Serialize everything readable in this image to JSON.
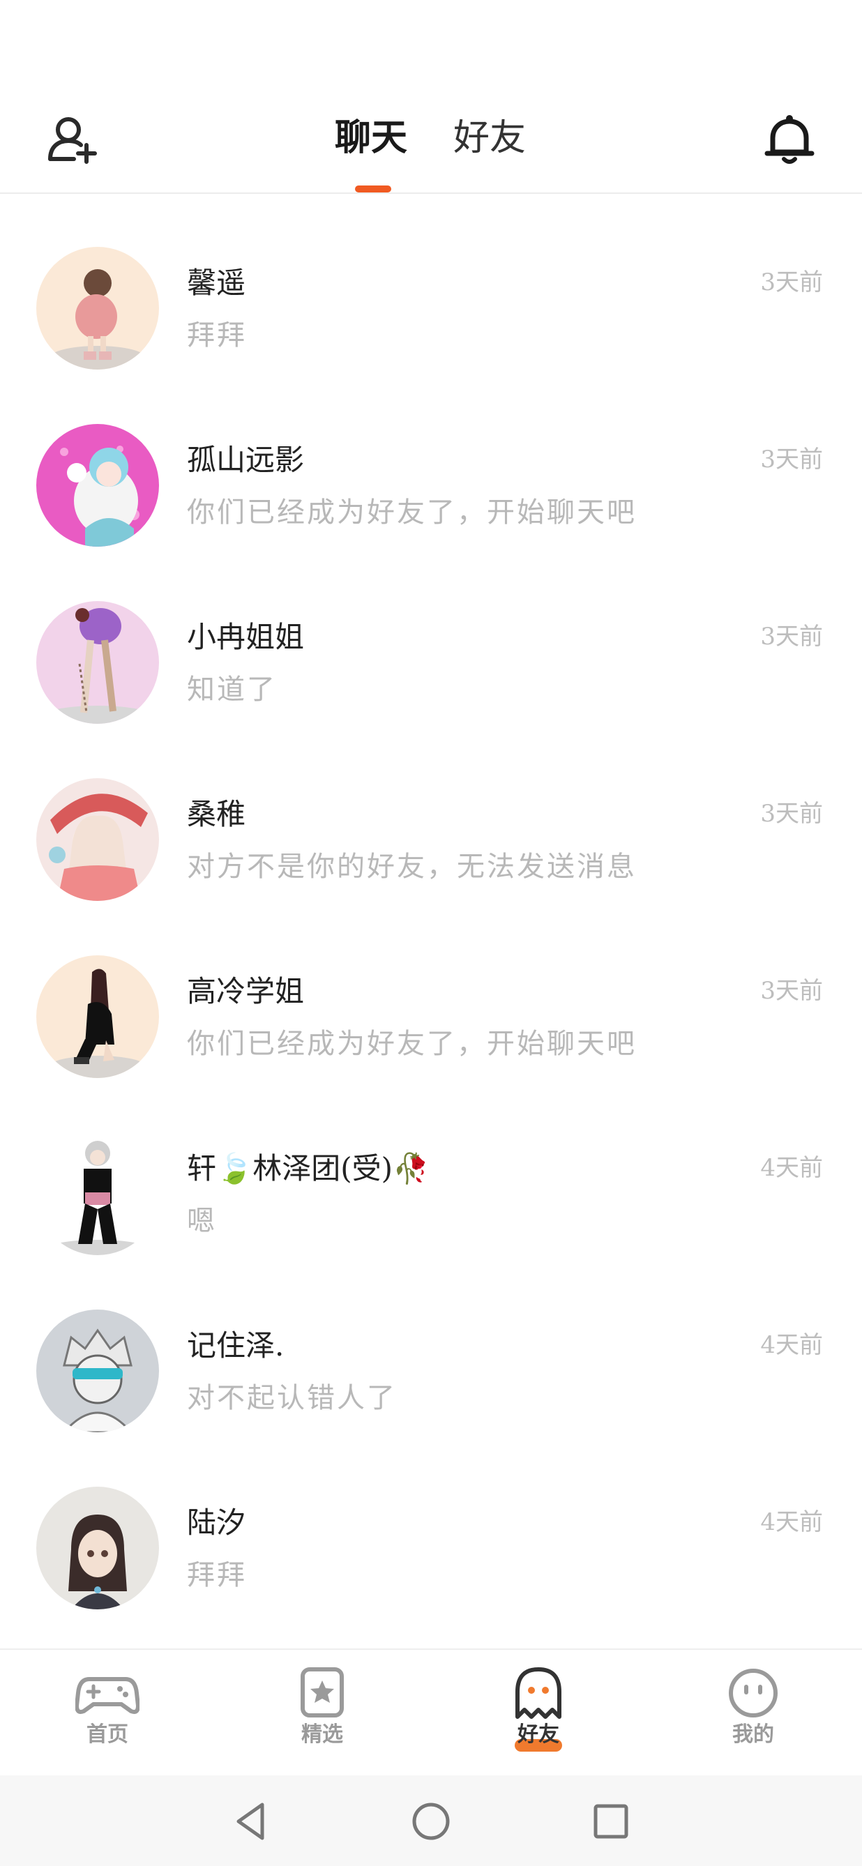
{
  "header": {
    "tabs": [
      {
        "label": "聊天",
        "active": true
      },
      {
        "label": "好友",
        "active": false
      }
    ],
    "left_icon": "add-user-icon",
    "right_icon": "bell-icon",
    "accent_color": "#f05a22"
  },
  "chats": [
    {
      "name": "馨遥",
      "preview": "拜拜",
      "time": "3天前"
    },
    {
      "name": "孤山远影",
      "preview": "你们已经成为好友了，开始聊天吧",
      "time": "3天前"
    },
    {
      "name": "小冉姐姐",
      "preview": "知道了",
      "time": "3天前"
    },
    {
      "name": "桑稚",
      "preview": "对方不是你的好友，无法发送消息",
      "time": "3天前"
    },
    {
      "name": "高冷学姐",
      "preview": "你们已经成为好友了，开始聊天吧",
      "time": "3天前"
    },
    {
      "name": "轩🍃林泽团(受)🥀",
      "preview": "嗯",
      "time": "4天前"
    },
    {
      "name": "记住泽.",
      "preview": "对不起认错人了",
      "time": "4天前"
    },
    {
      "name": "陆汐",
      "preview": "拜拜",
      "time": "4天前"
    }
  ],
  "bottom_nav": [
    {
      "label": "首页",
      "icon": "gamepad-icon",
      "active": false
    },
    {
      "label": "精选",
      "icon": "star-bookmark-icon",
      "active": false
    },
    {
      "label": "好友",
      "icon": "ghost-icon",
      "active": true
    },
    {
      "label": "我的",
      "icon": "smiley-icon",
      "active": false
    }
  ],
  "system_nav": [
    "back-icon",
    "home-icon",
    "recents-icon"
  ]
}
